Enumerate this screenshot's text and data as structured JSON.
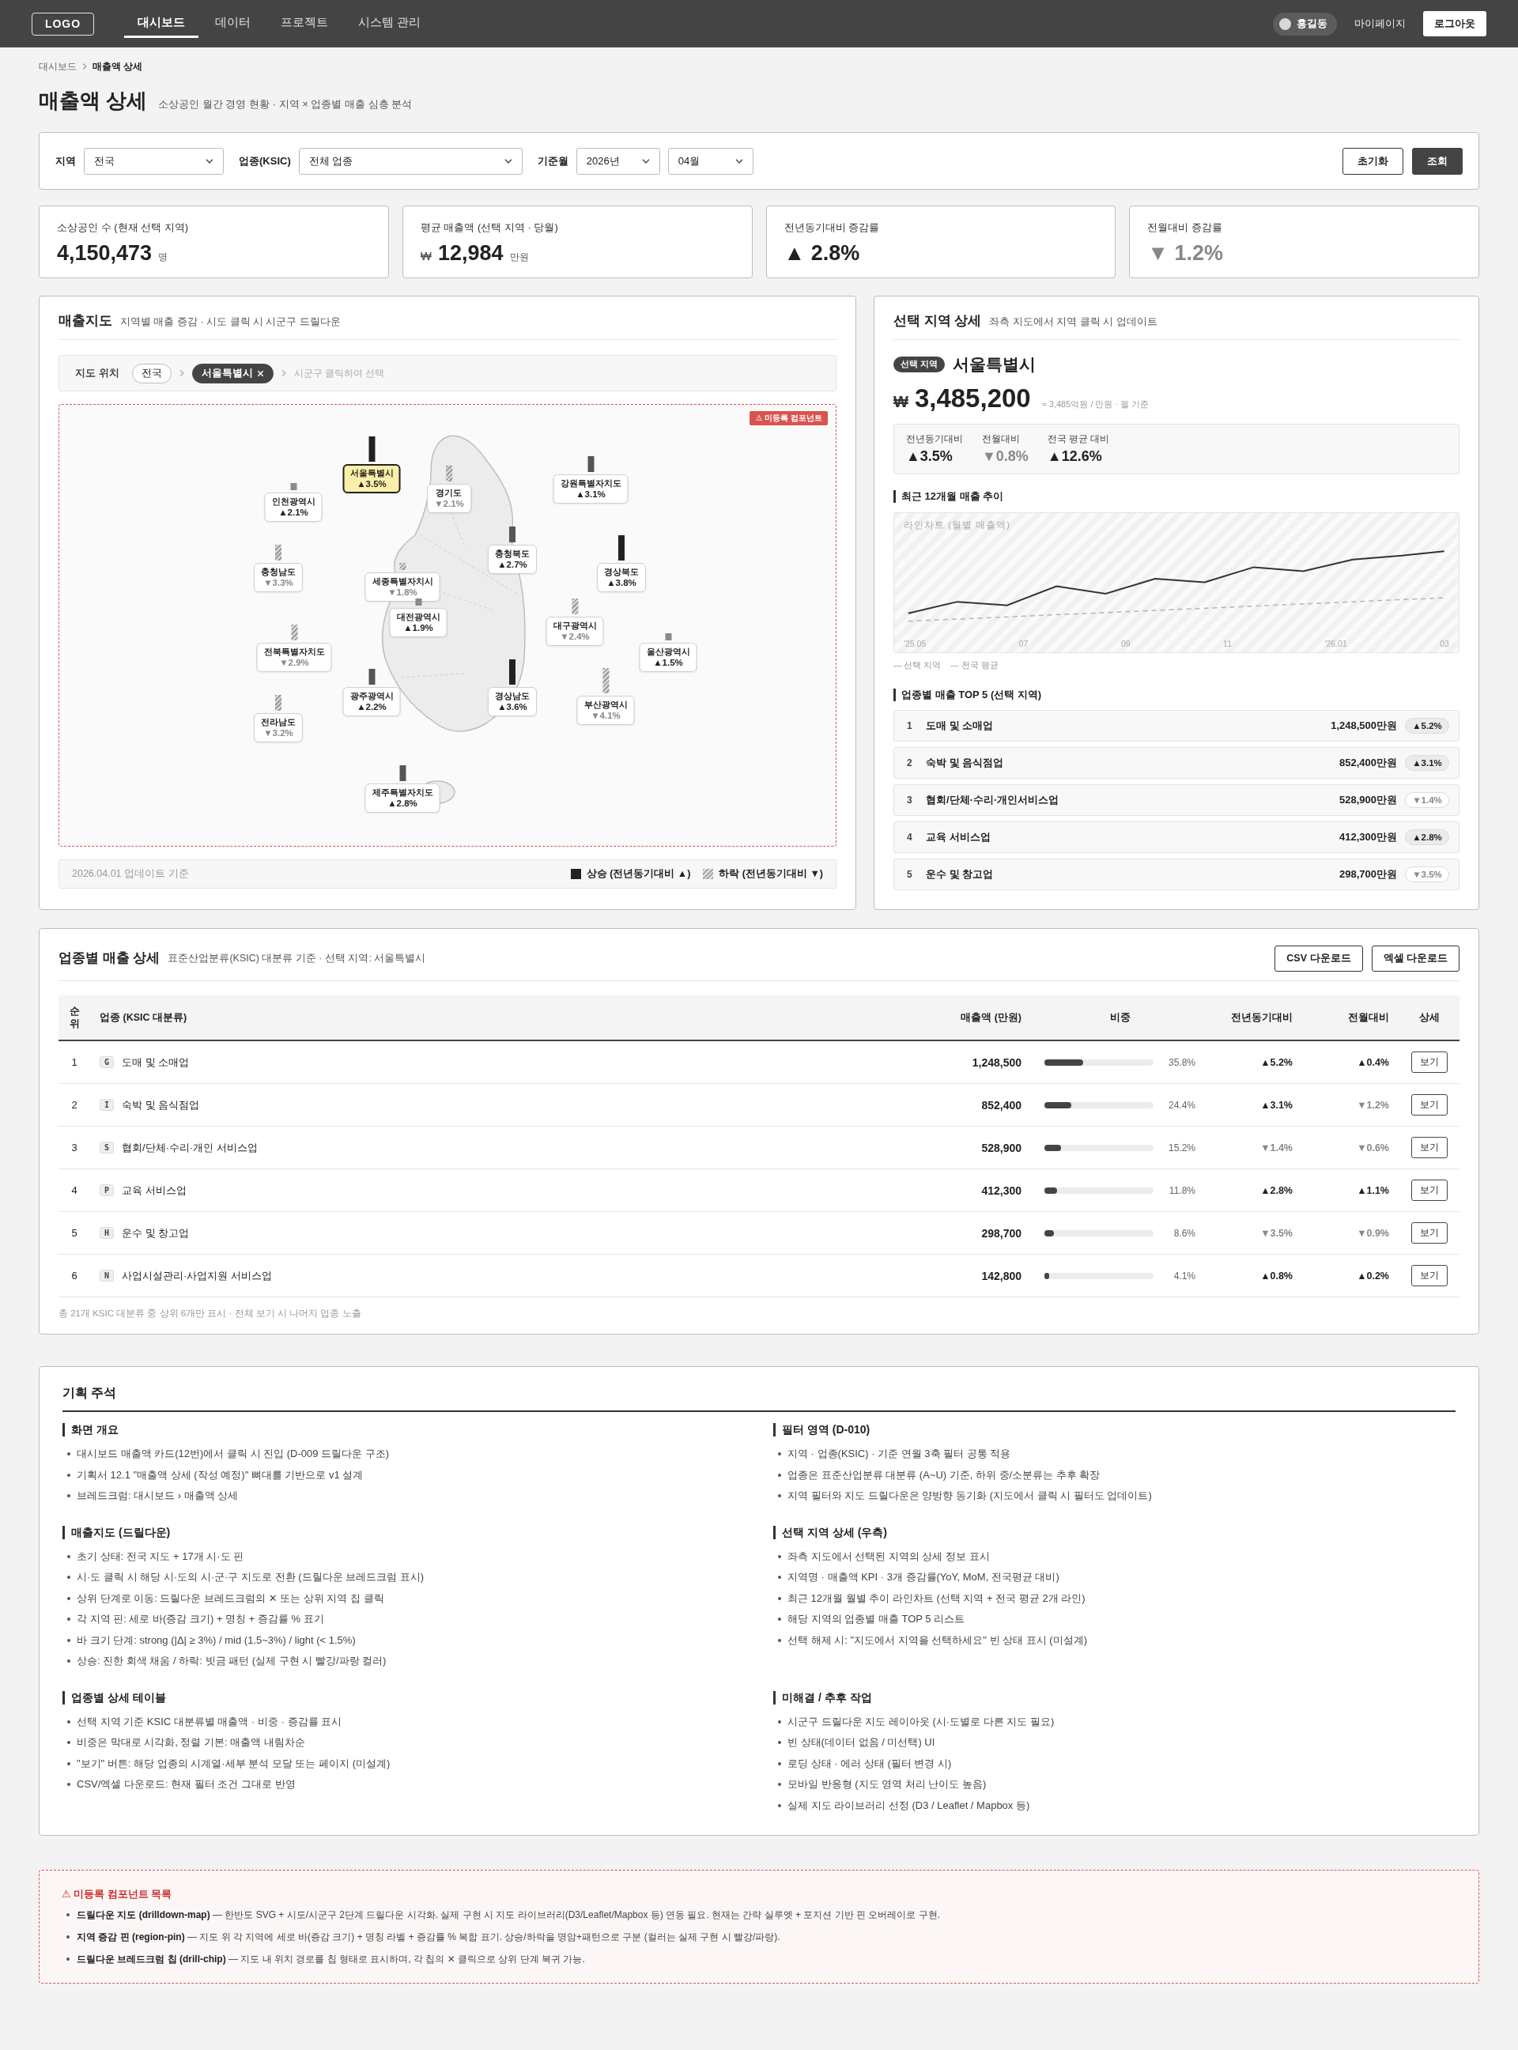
{
  "header": {
    "logo": "LOGO",
    "nav": [
      {
        "label": "대시보드",
        "selected": true
      },
      {
        "label": "데이터",
        "selected": false
      },
      {
        "label": "프로젝트",
        "selected": false
      },
      {
        "label": "시스템 관리",
        "selected": false
      }
    ],
    "user": "홍길동",
    "mypage": "마이페이지",
    "logout": "로그아웃"
  },
  "breadcrumb": [
    {
      "label": "대시보드",
      "current": false
    },
    {
      "label": "매출액 상세",
      "current": true
    }
  ],
  "page": {
    "title": "매출액 상세",
    "subtitle": "소상공인 월간 경영 현황 · 지역 × 업종별 매출 심층 분석"
  },
  "filters": {
    "fields": [
      {
        "label": "지역",
        "values": [
          "전국"
        ]
      },
      {
        "label": "업종(KSIC)",
        "values": [
          "전체 업종"
        ]
      },
      {
        "label": "기준월",
        "values": [
          "2026년",
          "04월"
        ]
      }
    ],
    "buttons": [
      {
        "label": "초기화",
        "kind": "outline"
      },
      {
        "label": "조회",
        "kind": "primary"
      }
    ]
  },
  "kpis": [
    {
      "label": "소상공인 수 (현재 선택 지역)",
      "value": "4,150,473",
      "unit": "명",
      "muted": false
    },
    {
      "label": "평균 매출액 (선택 지역 · 당월)",
      "prefix": "₩",
      "value": "12,984",
      "unit": "만원",
      "muted": false
    },
    {
      "label": "전년동기대비 증감률",
      "value": "▲ 2.8%",
      "muted": false
    },
    {
      "label": "전월대비 증감률",
      "value": "▼ 1.2%",
      "muted": true
    }
  ],
  "map": {
    "title": "매출지도",
    "subtitle": "지역별 매출 증감 · 시도 클릭 시 시군구 드릴다운",
    "location_label": "지도 위치",
    "chips": [
      {
        "label": "전국",
        "selected": false
      },
      {
        "label": "서울특별시",
        "selected": true
      }
    ],
    "hint": "시군구 클릭하여 선택",
    "badge": "⚠ 미등록 컴포넌트",
    "pins": [
      {
        "name": "서울특별시",
        "change": "▲3.5%",
        "up": true,
        "kind": "strong",
        "selected": true
      },
      {
        "name": "인천광역시",
        "change": "▲2.1%",
        "up": true,
        "kind": "light",
        "selected": false
      },
      {
        "name": "경기도",
        "change": "▼2.1%",
        "up": false,
        "kind": "mid",
        "selected": false
      },
      {
        "name": "강원특별자치도",
        "change": "▲3.1%",
        "up": true,
        "kind": "mid",
        "selected": false
      },
      {
        "name": "충청북도",
        "change": "▲2.7%",
        "up": true,
        "kind": "mid",
        "selected": false
      },
      {
        "name": "충청남도",
        "change": "▼3.3%",
        "up": false,
        "kind": "mid",
        "selected": false
      },
      {
        "name": "경상북도",
        "change": "▲3.8%",
        "up": true,
        "kind": "strong",
        "selected": false
      },
      {
        "name": "세종특별자치시",
        "change": "▼1.8%",
        "up": false,
        "kind": "light",
        "selected": false
      },
      {
        "name": "대전광역시",
        "change": "▲1.9%",
        "up": true,
        "kind": "light",
        "selected": false
      },
      {
        "name": "대구광역시",
        "change": "▼2.4%",
        "up": false,
        "kind": "mid",
        "selected": false
      },
      {
        "name": "전북특별자치도",
        "change": "▼2.9%",
        "up": false,
        "kind": "mid",
        "selected": false
      },
      {
        "name": "울산광역시",
        "change": "▲1.5%",
        "up": true,
        "kind": "light",
        "selected": false
      },
      {
        "name": "광주광역시",
        "change": "▲2.2%",
        "up": true,
        "kind": "mid",
        "selected": false
      },
      {
        "name": "경상남도",
        "change": "▲3.6%",
        "up": true,
        "kind": "strong",
        "selected": false
      },
      {
        "name": "부산광역시",
        "change": "▼4.1%",
        "up": false,
        "kind": "strong",
        "selected": false
      },
      {
        "name": "전라남도",
        "change": "▼3.2%",
        "up": false,
        "kind": "mid",
        "selected": false
      },
      {
        "name": "제주특별자치도",
        "change": "▲2.8%",
        "up": true,
        "kind": "mid",
        "selected": false
      }
    ],
    "updated": "2026.04.01 업데이트 기준",
    "legend": [
      {
        "label": "상승 (전년동기대비 ▲)",
        "up": true
      },
      {
        "label": "하락 (전년동기대비 ▼)",
        "up": false
      }
    ]
  },
  "detail": {
    "title": "선택 지역 상세",
    "subtitle": "좌측 지도에서 지역 클릭 시 업데이트",
    "badge": "선택 지역",
    "region": "서울특별시",
    "currency": "₩",
    "amount": "3,485,200",
    "amount_note": "≈ 3,485억원 / 만원 · 월 기준",
    "metrics": [
      {
        "label": "전년동기대비",
        "value": "▲3.5%",
        "up": true
      },
      {
        "label": "전월대비",
        "value": "▼0.8%",
        "up": false
      },
      {
        "label": "전국 평균 대비",
        "value": "▲12.6%",
        "up": true
      }
    ],
    "trend": {
      "heading": "최근 12개월 매출 추이",
      "chart_label": "라인차트 (월별 매출액)",
      "x_labels": [
        "'25.05",
        "07",
        "09",
        "11",
        "'26.01",
        "03"
      ],
      "legend": [
        "— 선택 지역",
        "--- 전국 평균"
      ]
    },
    "top5": {
      "heading": "업종별 매출 TOP 5 (선택 지역)",
      "rows": [
        {
          "rank": "1",
          "name": "도매 및 소매업",
          "amount": "1,248,500만원",
          "change": "▲5.2%",
          "up": true
        },
        {
          "rank": "2",
          "name": "숙박 및 음식점업",
          "amount": "852,400만원",
          "change": "▲3.1%",
          "up": true
        },
        {
          "rank": "3",
          "name": "협회/단체·수리·개인서비스업",
          "amount": "528,900만원",
          "change": "▼1.4%",
          "up": false
        },
        {
          "rank": "4",
          "name": "교육 서비스업",
          "amount": "412,300만원",
          "change": "▲2.8%",
          "up": true
        },
        {
          "rank": "5",
          "name": "운수 및 창고업",
          "amount": "298,700만원",
          "change": "▼3.5%",
          "up": false
        }
      ]
    }
  },
  "table": {
    "title": "업종별 매출 상세",
    "subtitle": "표준산업분류(KSIC) 대분류 기준 · 선택 지역: 서울특별시",
    "buttons": [
      "CSV 다운로드",
      "엑셀 다운로드"
    ],
    "columns": [
      "순위",
      "업종 (KSIC 대분류)",
      "매출액 (만원)",
      "비중",
      "전년동기대비",
      "전월대비",
      "상세"
    ],
    "rows": [
      {
        "rank": "1",
        "code": "G",
        "name": "도매 및 소매업",
        "amount": "1,248,500",
        "share": "35.8%",
        "level": 0.358,
        "yoy": {
          "text": "▲5.2%",
          "up": true
        },
        "mom": {
          "text": "▲0.4%",
          "up": true
        },
        "action": "보기"
      },
      {
        "rank": "2",
        "code": "I",
        "name": "숙박 및 음식점업",
        "amount": "852,400",
        "share": "24.4%",
        "level": 0.244,
        "yoy": {
          "text": "▲3.1%",
          "up": true
        },
        "mom": {
          "text": "▼1.2%",
          "up": false
        },
        "action": "보기"
      },
      {
        "rank": "3",
        "code": "S",
        "name": "협회/단체·수리·개인 서비스업",
        "amount": "528,900",
        "share": "15.2%",
        "level": 0.152,
        "yoy": {
          "text": "▼1.4%",
          "up": false
        },
        "mom": {
          "text": "▼0.6%",
          "up": false
        },
        "action": "보기"
      },
      {
        "rank": "4",
        "code": "P",
        "name": "교육 서비스업",
        "amount": "412,300",
        "share": "11.8%",
        "level": 0.118,
        "yoy": {
          "text": "▲2.8%",
          "up": true
        },
        "mom": {
          "text": "▲1.1%",
          "up": true
        },
        "action": "보기"
      },
      {
        "rank": "5",
        "code": "H",
        "name": "운수 및 창고업",
        "amount": "298,700",
        "share": "8.6%",
        "level": 0.086,
        "yoy": {
          "text": "▼3.5%",
          "up": false
        },
        "mom": {
          "text": "▼0.9%",
          "up": false
        },
        "action": "보기"
      },
      {
        "rank": "6",
        "code": "N",
        "name": "사업시설관리·사업지원 서비스업",
        "amount": "142,800",
        "share": "4.1%",
        "level": 0.041,
        "yoy": {
          "text": "▲0.8%",
          "up": true
        },
        "mom": {
          "text": "▲0.2%",
          "up": true
        },
        "action": "보기"
      }
    ],
    "footnote": "총 21개 KSIC 대분류 중 상위 6개만 표시 · 전체 보기 시 나머지 업종 노출"
  },
  "notes": {
    "title": "기획 주석",
    "sections": [
      {
        "heading": "화면 개요",
        "items": [
          "대시보드 매출액 카드(12번)에서 클릭 시 진입 (D-009 드릴다운 구조)",
          "기획서 12.1 \"매출액 상세 (작성 예정)\" 뼈대를 기반으로 v1 설계",
          "브레드크럼: 대시보드 › 매출액 상세"
        ]
      },
      {
        "heading": "필터 영역 (D-010)",
        "items": [
          "지역 · 업종(KSIC) · 기준 연월 3축 필터 공통 적용",
          "업종은 표준산업분류 대분류 (A~U) 기준, 하위 중/소분류는 추후 확장",
          "지역 필터와 지도 드릴다운은 양방향 동기화 (지도에서 클릭 시 필터도 업데이트)"
        ]
      },
      {
        "heading": "매출지도 (드릴다운)",
        "items": [
          "초기 상태: 전국 지도 + 17개 시·도 핀",
          "시·도 클릭 시 해당 시·도의 시·군·구 지도로 전환 (드릴다운 브레드크럼 표시)",
          "상위 단계로 이동: 드릴다운 브레드크럼의 ✕ 또는 상위 지역 칩 클릭",
          "각 지역 핀: 세로 바(증감 크기) + 명칭 + 증감률 % 표기",
          "바 크기 단계: strong (|Δ| ≥ 3%) / mid (1.5~3%) / light (< 1.5%)",
          "상승: 진한 회색 채움 / 하락: 빗금 패턴 (실제 구현 시 빨강/파랑 컬러)"
        ]
      },
      {
        "heading": "선택 지역 상세 (우측)",
        "items": [
          "좌측 지도에서 선택된 지역의 상세 정보 표시",
          "지역명 · 매출액 KPI · 3개 증감률(YoY, MoM, 전국평균 대비)",
          "최근 12개월 월별 추이 라인차트 (선택 지역 + 전국 평균 2개 라인)",
          "해당 지역의 업종별 매출 TOP 5 리스트",
          "선택 해제 시: \"지도에서 지역을 선택하세요\" 빈 상태 표시 (미설계)"
        ]
      },
      {
        "heading": "업종별 상세 테이블",
        "items": [
          "선택 지역 기준 KSIC 대분류별 매출액 · 비중 · 증감률 표시",
          "비중은 막대로 시각화, 정렬 기본: 매출액 내림차순",
          "\"보기\" 버튼: 해당 업종의 시계열·세부 분석 모달 또는 페이지 (미설계)",
          "CSV/엑셀 다운로드: 현재 필터 조건 그대로 반영"
        ]
      },
      {
        "heading": "미해결 / 추후 작업",
        "items": [
          "시군구 드릴다운 지도 레이아웃 (시·도별로 다른 지도 필요)",
          "빈 상태(데이터 없음 / 미선택) UI",
          "로딩 상태 · 에러 상태 (필터 변경 시)",
          "모바일 반응형 (지도 영역 처리 난이도 높음)",
          "실제 지도 라이브러리 선정 (D3 / Leaflet / Mapbox 등)"
        ]
      }
    ]
  },
  "unregistered": {
    "title": "⚠ 미등록 컴포넌트 목록",
    "items": [
      "**드릴다운 지도 (drilldown-map)** — 한반도 SVG + 시도/시군구 2단계 드릴다운 시각화. 실제 구현 시 지도 라이브러리(D3/Leaflet/Mapbox 등) 연동 필요. 현재는 간략 실루엣 + 포지션 기반 핀 오버레이로 구현.",
      "**지역 증감 핀 (region-pin)** — 지도 위 각 지역에 세로 바(증감 크기) + 명칭 라벨 + 증감률 % 복합 표기. 상승/하락을 명암+패턴으로 구분 (컬러는 실제 구현 시 빨강/파랑).",
      "**드릴다운 브레드크럼 칩 (drill-chip)** — 지도 내 위치 경로를 칩 형태로 표시하며, 각 칩의 ✕ 클릭으로 상위 단계 복귀 가능."
    ]
  }
}
